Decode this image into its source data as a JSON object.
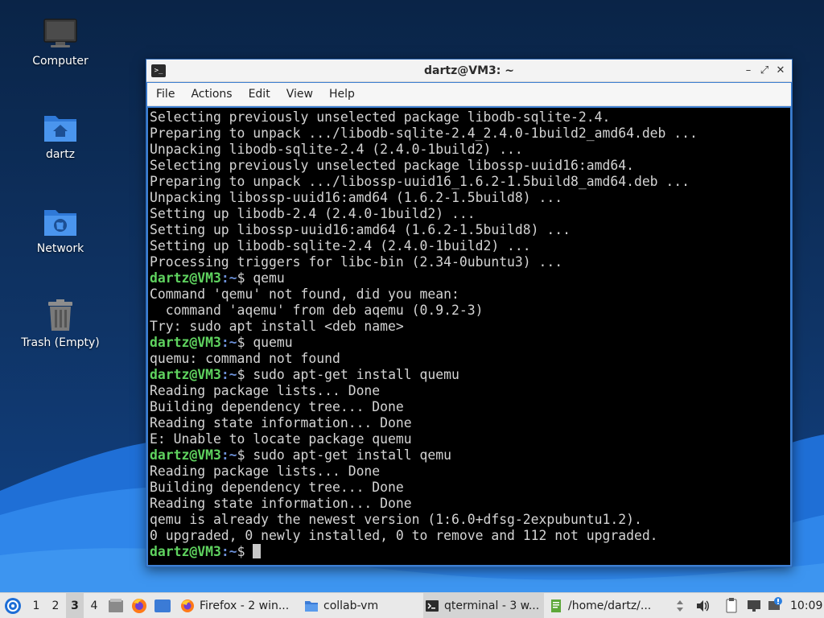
{
  "desktop": {
    "icons": [
      {
        "label": "Computer",
        "icon": "computer-icon"
      },
      {
        "label": "dartz",
        "icon": "home-folder-icon"
      },
      {
        "label": "Network",
        "icon": "network-folder-icon"
      },
      {
        "label": "Trash (Empty)",
        "icon": "trash-icon"
      }
    ]
  },
  "window": {
    "title": "dartz@VM3: ~",
    "controls": {
      "minimize": "–",
      "maximize": "⤢",
      "close": "✕"
    },
    "menu": [
      "File",
      "Actions",
      "Edit",
      "View",
      "Help"
    ]
  },
  "terminal": {
    "prompt_user": "dartz@VM3",
    "prompt_path": ":~",
    "prompt_symbol": "$ ",
    "lines": [
      {
        "text": "Selecting previously unselected package libodb-sqlite-2.4."
      },
      {
        "text": "Preparing to unpack .../libodb-sqlite-2.4_2.4.0-1build2_amd64.deb ..."
      },
      {
        "text": "Unpacking libodb-sqlite-2.4 (2.4.0-1build2) ..."
      },
      {
        "text": "Selecting previously unselected package libossp-uuid16:amd64."
      },
      {
        "text": "Preparing to unpack .../libossp-uuid16_1.6.2-1.5build8_amd64.deb ..."
      },
      {
        "text": "Unpacking libossp-uuid16:amd64 (1.6.2-1.5build8) ..."
      },
      {
        "text": "Setting up libodb-2.4 (2.4.0-1build2) ..."
      },
      {
        "text": "Setting up libossp-uuid16:amd64 (1.6.2-1.5build8) ..."
      },
      {
        "text": "Setting up libodb-sqlite-2.4 (2.4.0-1build2) ..."
      },
      {
        "text": "Processing triggers for libc-bin (2.34-0ubuntu3) ..."
      },
      {
        "prompt": true,
        "text": "qemu"
      },
      {
        "text": "Command 'qemu' not found, did you mean:"
      },
      {
        "text": "  command 'aqemu' from deb aqemu (0.9.2-3)"
      },
      {
        "text": "Try: sudo apt install <deb name>"
      },
      {
        "prompt": true,
        "text": "quemu"
      },
      {
        "text": "quemu: command not found"
      },
      {
        "prompt": true,
        "text": "sudo apt-get install quemu"
      },
      {
        "text": "Reading package lists... Done"
      },
      {
        "text": "Building dependency tree... Done"
      },
      {
        "text": "Reading state information... Done"
      },
      {
        "text": "E: Unable to locate package quemu"
      },
      {
        "prompt": true,
        "text": "sudo apt-get install qemu"
      },
      {
        "text": "Reading package lists... Done"
      },
      {
        "text": "Building dependency tree... Done"
      },
      {
        "text": "Reading state information... Done"
      },
      {
        "text": "qemu is already the newest version (1:6.0+dfsg-2expubuntu1.2)."
      },
      {
        "text": "0 upgraded, 0 newly installed, 0 to remove and 112 not upgraded."
      },
      {
        "prompt": true,
        "text": "",
        "cursor": true
      }
    ]
  },
  "taskbar": {
    "workspaces": [
      "1",
      "2",
      "3",
      "4"
    ],
    "active_workspace": "3",
    "tasks": [
      {
        "label": "Firefox - 2 win...",
        "icon": "firefox-icon"
      },
      {
        "label": "collab-vm",
        "icon": "folder-icon"
      },
      {
        "label": "qterminal - 3 w...",
        "icon": "terminal-icon"
      },
      {
        "label": "/home/dartz/...",
        "icon": "text-editor-icon"
      }
    ],
    "clock": "10:09"
  },
  "colors": {
    "prompt_user": "#5fd35f",
    "prompt_path": "#6b8fd6",
    "window_border": "#3d7fd1",
    "terminal_bg": "#000000"
  }
}
